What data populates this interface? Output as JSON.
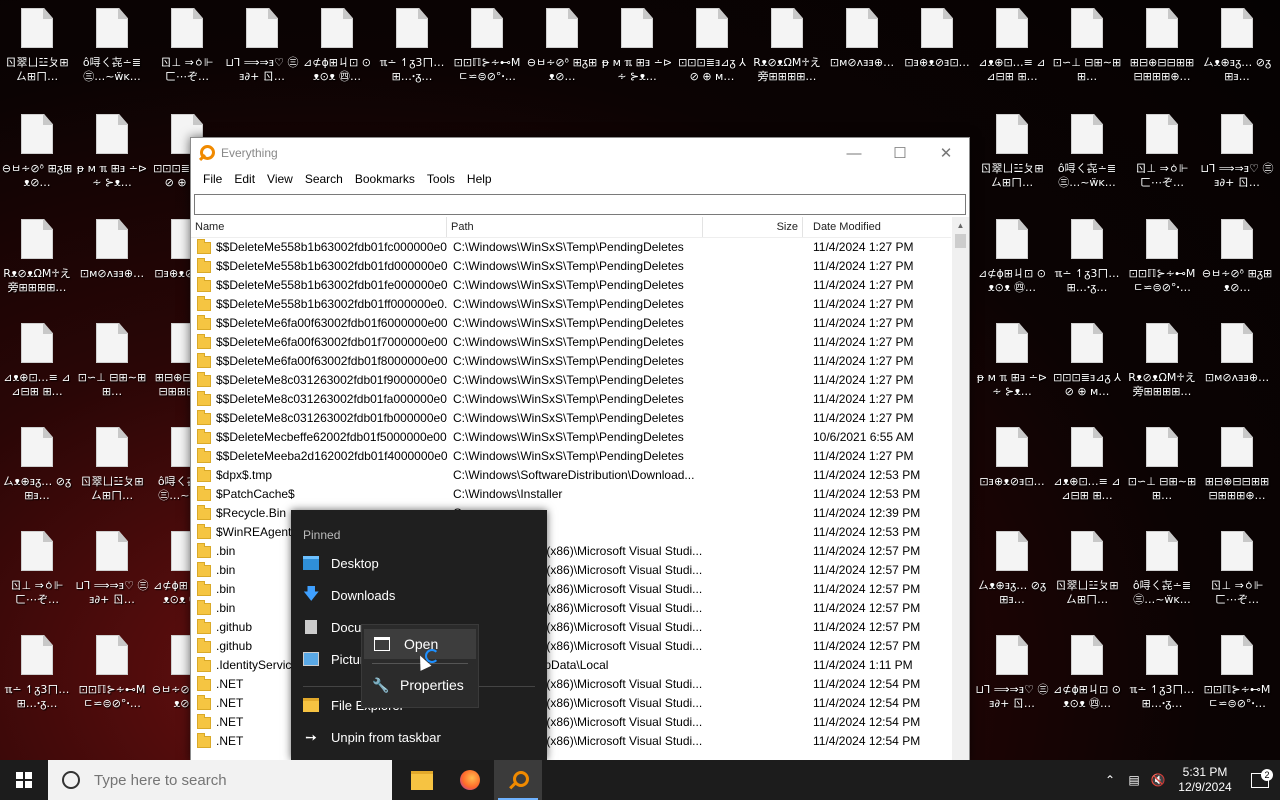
{
  "desktop_icons": [
    {
      "label": "ㄖ翠ㄩ☳ㄆ⊞ㄙ⊞ㄇ…"
    },
    {
      "label": "ô㖊ㄑ㐂∸≣ ㊂…~ẅĸ…"
    },
    {
      "label": "ㄖ⊥ ⇒ㆁ⊩ㄈ⋯ぞ…"
    },
    {
      "label": "⊔Ꞁ ⟹⇒ⱻ♡ ㊂ⱻ∂+ ㄖ…"
    },
    {
      "label": "⊿⊄ɸ⊞ㄐ⊡ ⊙ᴥ⊙ᴥ ㊃…"
    },
    {
      "label": "ℼ∸ ↿ᵹ3ㄇ… ⊞…ꞏᵹ…"
    },
    {
      "label": "⊡⊡ℿ⊱∻⊷M ㄷ⋍⊜⊘°ꞏ…"
    },
    {
      "label": "⊖ㅂ∻⊘ᶞ ⊞ᵹ⊞ᴥ⊘…"
    },
    {
      "label": "ᵽ ᴍ ℼ ⊞ⱻ ∸⊳∻ ⊱ᴥ…"
    },
    {
      "label": "⊡⊡⊡≣ⱻ⊿ᵹ ⅄⊘ ⊕ ᴍ…"
    },
    {
      "label": "Rᴥ⊘ᴥΩM♱え 旁⊞⊞⊞⊞…"
    },
    {
      "label": "⊡ᴍ⊘ᴧⱻⱻ⊕…"
    },
    {
      "label": "⊡ⱻ⊕ᴥ⊘ⱻ⊡…"
    },
    {
      "label": "⊿ᴥ⊕⊡…≡ ⊿⊿⊟⊞ ⊞…"
    },
    {
      "label": "⊡∽⊥ ⊟⊞∼⊞⊞…"
    },
    {
      "label": "⊞⊟⊕⊟⊟⊞⊞ ⊟⊞⊞⊞⊕…"
    },
    {
      "label": "ㄙᴥ⊕ⱻᵹ… ⊘ᵹ⊞ⱻ…"
    }
  ],
  "window": {
    "title": "Everything",
    "menu": [
      "File",
      "Edit",
      "View",
      "Search",
      "Bookmarks",
      "Tools",
      "Help"
    ],
    "search_value": "",
    "columns": {
      "name": "Name",
      "path": "Path",
      "size": "Size",
      "date": "Date Modified"
    },
    "rows": [
      {
        "name": "$$DeleteMe558b1b63002fdb01fc000000e0...",
        "path": "C:\\Windows\\WinSxS\\Temp\\PendingDeletes",
        "size": "",
        "date": "11/4/2024 1:27 PM"
      },
      {
        "name": "$$DeleteMe558b1b63002fdb01fd000000e0...",
        "path": "C:\\Windows\\WinSxS\\Temp\\PendingDeletes",
        "size": "",
        "date": "11/4/2024 1:27 PM"
      },
      {
        "name": "$$DeleteMe558b1b63002fdb01fe000000e0...",
        "path": "C:\\Windows\\WinSxS\\Temp\\PendingDeletes",
        "size": "",
        "date": "11/4/2024 1:27 PM"
      },
      {
        "name": "$$DeleteMe558b1b63002fdb01ff000000e0...",
        "path": "C:\\Windows\\WinSxS\\Temp\\PendingDeletes",
        "size": "",
        "date": "11/4/2024 1:27 PM"
      },
      {
        "name": "$$DeleteMe6fa00f63002fdb01f6000000e00...",
        "path": "C:\\Windows\\WinSxS\\Temp\\PendingDeletes",
        "size": "",
        "date": "11/4/2024 1:27 PM"
      },
      {
        "name": "$$DeleteMe6fa00f63002fdb01f7000000e00...",
        "path": "C:\\Windows\\WinSxS\\Temp\\PendingDeletes",
        "size": "",
        "date": "11/4/2024 1:27 PM"
      },
      {
        "name": "$$DeleteMe6fa00f63002fdb01f8000000e00...",
        "path": "C:\\Windows\\WinSxS\\Temp\\PendingDeletes",
        "size": "",
        "date": "11/4/2024 1:27 PM"
      },
      {
        "name": "$$DeleteMe8c031263002fdb01f9000000e00...",
        "path": "C:\\Windows\\WinSxS\\Temp\\PendingDeletes",
        "size": "",
        "date": "11/4/2024 1:27 PM"
      },
      {
        "name": "$$DeleteMe8c031263002fdb01fa000000e00...",
        "path": "C:\\Windows\\WinSxS\\Temp\\PendingDeletes",
        "size": "",
        "date": "11/4/2024 1:27 PM"
      },
      {
        "name": "$$DeleteMe8c031263002fdb01fb000000e00...",
        "path": "C:\\Windows\\WinSxS\\Temp\\PendingDeletes",
        "size": "",
        "date": "11/4/2024 1:27 PM"
      },
      {
        "name": "$$DeleteMecbeffe62002fdb01f5000000e00...",
        "path": "C:\\Windows\\WinSxS\\Temp\\PendingDeletes",
        "size": "",
        "date": "10/6/2021 6:55 AM"
      },
      {
        "name": "$$DeleteMeeba2d162002fdb01f4000000e0...",
        "path": "C:\\Windows\\WinSxS\\Temp\\PendingDeletes",
        "size": "",
        "date": "11/4/2024 1:27 PM"
      },
      {
        "name": "$dpx$.tmp",
        "path": "C:\\Windows\\SoftwareDistribution\\Download...",
        "size": "",
        "date": "11/4/2024 12:53 PM"
      },
      {
        "name": "$PatchCache$",
        "path": "C:\\Windows\\Installer",
        "size": "",
        "date": "11/4/2024 12:53 PM"
      },
      {
        "name": "$Recycle.Bin",
        "path": "C:",
        "size": "",
        "date": "11/4/2024 12:39 PM"
      },
      {
        "name": "$WinREAgent",
        "path": "C:",
        "size": "",
        "date": "11/4/2024 12:53 PM"
      },
      {
        "name": ".bin",
        "path": "C:\\Program Files (x86)\\Microsoft Visual Studi...",
        "size": "",
        "date": "11/4/2024 12:57 PM"
      },
      {
        "name": ".bin",
        "path": "C:\\Program Files (x86)\\Microsoft Visual Studi...",
        "size": "",
        "date": "11/4/2024 12:57 PM"
      },
      {
        "name": ".bin",
        "path": "C:\\Program Files (x86)\\Microsoft Visual Studi...",
        "size": "",
        "date": "11/4/2024 12:57 PM"
      },
      {
        "name": ".bin",
        "path": "C:\\Program Files (x86)\\Microsoft Visual Studi...",
        "size": "",
        "date": "11/4/2024 12:57 PM"
      },
      {
        "name": ".github",
        "path": "C:\\Program Files (x86)\\Microsoft Visual Studi...",
        "size": "",
        "date": "11/4/2024 12:57 PM"
      },
      {
        "name": ".github",
        "path": "C:\\Program Files (x86)\\Microsoft Visual Studi...",
        "size": "",
        "date": "11/4/2024 12:57 PM"
      },
      {
        "name": ".IdentityService",
        "path": "C:\\Users\\user\\AppData\\Local",
        "size": "",
        "date": "11/4/2024 1:11 PM"
      },
      {
        "name": ".NET",
        "path": "C:\\Program Files (x86)\\Microsoft Visual Studi...",
        "size": "",
        "date": "11/4/2024 12:54 PM"
      },
      {
        "name": ".NET",
        "path": "C:\\Program Files (x86)\\Microsoft Visual Studi...",
        "size": "",
        "date": "11/4/2024 12:54 PM"
      },
      {
        "name": ".NET",
        "path": "C:\\Program Files (x86)\\Microsoft Visual Studi...",
        "size": "",
        "date": "11/4/2024 12:54 PM"
      },
      {
        "name": ".NET",
        "path": "C:\\Program Files (x86)\\Microsoft Visual Studi...",
        "size": "",
        "date": "11/4/2024 12:54 PM"
      }
    ]
  },
  "jumplist": {
    "pinned_label": "Pinned",
    "desktop": "Desktop",
    "downloads": "Downloads",
    "documents": "Docu",
    "pictures": "Pictur",
    "file_explorer": "File Explorer",
    "unpin": "Unpin from taskbar"
  },
  "context_menu": {
    "open": "Open",
    "properties": "Properties"
  },
  "taskbar": {
    "search_placeholder": "Type here to search",
    "time": "5:31 PM",
    "date": "12/9/2024",
    "notification_count": "2"
  }
}
